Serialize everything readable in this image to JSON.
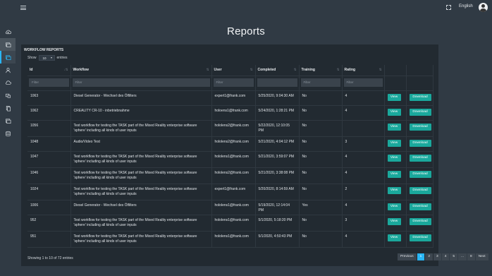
{
  "topbar": {
    "language": "English"
  },
  "page": {
    "title": "Reports"
  },
  "panel": {
    "heading": "WORKFLOW REPORTS",
    "show_prefix": "Show",
    "show_value": "10",
    "show_suffix": "entries"
  },
  "table": {
    "columns": [
      "Id",
      "Workflow",
      "User",
      "Completed",
      "Training",
      "Rating"
    ],
    "filter_placeholder": "Filter",
    "view_label": "View",
    "download_label": "Download",
    "rows": [
      {
        "id": "1063",
        "workflow": "Diesel Generator - Wechsel des Ölfilters",
        "user": "expert1@frank.com",
        "completed": "5/25/2020, 9:04:30 AM",
        "training": "No",
        "rating": "4"
      },
      {
        "id": "1062",
        "workflow": "CREALITY CR-10 - inbetriebnahme",
        "user": "holoens1@frank.com",
        "completed": "5/24/2020, 1:28:21 PM",
        "training": "No",
        "rating": "4"
      },
      {
        "id": "1056",
        "workflow": "Test workflow for testing the TASK part of the Mixed Reality enterprise software 'sphere' including all kinds of user inputs",
        "user": "hololens2@frank.com",
        "completed": "5/22/2020, 12:10:05 PM",
        "training": "No",
        "rating": ""
      },
      {
        "id": "1048",
        "workflow": "Audio/Video Test",
        "user": "hololens2@frank.com",
        "completed": "5/21/2020, 4:04:12 PM",
        "training": "No",
        "rating": "3"
      },
      {
        "id": "1047",
        "workflow": "Test workflow for testing the TASK part of the Mixed Reality enterprise software 'sphere' including all kinds of user inputs",
        "user": "hololens1@frank.com",
        "completed": "5/21/2020, 3:59:07 PM",
        "training": "No",
        "rating": "4"
      },
      {
        "id": "1046",
        "workflow": "Test workflow for testing the TASK part of the Mixed Reality enterprise software 'sphere' including all kinds of user inputs",
        "user": "hololens2@frank.com",
        "completed": "5/21/2020, 3:38:08 PM",
        "training": "No",
        "rating": "4"
      },
      {
        "id": "1024",
        "workflow": "Test workflow for testing the TASK part of the Mixed Reality enterprise software 'sphere' including all kinds of user inputs",
        "user": "expert1@frank.com",
        "completed": "5/20/2020, 8:14:59 AM",
        "training": "No",
        "rating": "2"
      },
      {
        "id": "1006",
        "workflow": "Diesel Generator - Wechsel des Ölfilters",
        "user": "hololens1@frank.com",
        "completed": "5/19/2020, 12:14:04 PM",
        "training": "Yes",
        "rating": "4"
      },
      {
        "id": "952",
        "workflow": "Test workflow for testing the TASK part of the Mixed Reality enterprise software 'sphere' including all kinds of user inputs",
        "user": "hololens1@frank.com",
        "completed": "5/1/2020, 5:18:20 PM",
        "training": "No",
        "rating": "3"
      },
      {
        "id": "951",
        "workflow": "Test workflow for testing the TASK part of the Mixed Reality enterprise software 'sphere' including all kinds of user inputs",
        "user": "hololens1@frank.com",
        "completed": "5/1/2020, 4:50:43 PM",
        "training": "No",
        "rating": "4"
      }
    ]
  },
  "footer": {
    "info": "Showing 1 to 10 of 72 entries",
    "pages": [
      "Previous",
      "1",
      "2",
      "3",
      "4",
      "5",
      "...",
      "8",
      "Next"
    ],
    "current_page": "1"
  },
  "sidebar_icons": [
    "cloud-upload-icon",
    "reports-icon",
    "workflows-icon",
    "user-icon",
    "cloud-icon",
    "devices-icon",
    "documents-icon",
    "media-icon",
    "database-icon"
  ],
  "colors": {
    "accent": "#29b6f6",
    "button": "#1aa89c",
    "panel": "#222a31",
    "background": "#303a44"
  }
}
